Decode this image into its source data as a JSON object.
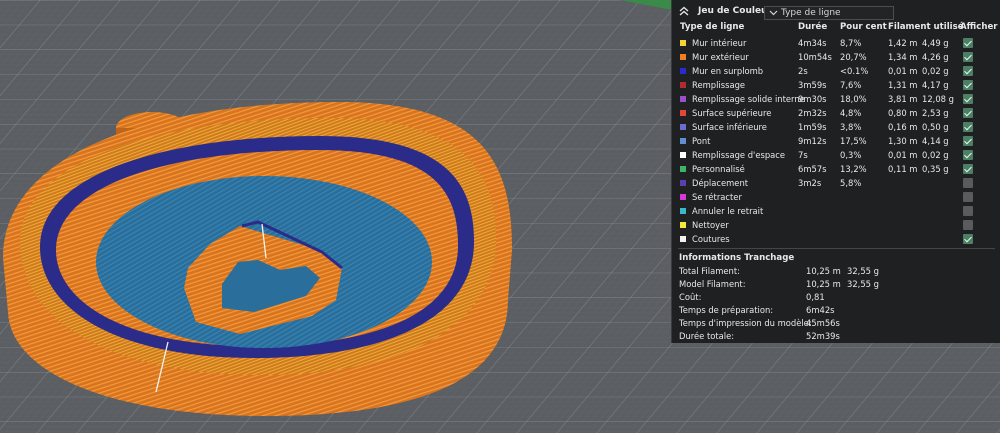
{
  "legend": {
    "title": "Jeu de Couleur",
    "filter_placeholder": "Type de ligne",
    "columns": [
      "Type de ligne",
      "Durée",
      "Pour cent",
      "Filament utilisé",
      "Afficher"
    ],
    "rows": [
      {
        "label": "Mur intérieur",
        "color": "#f2d33a",
        "time": "4m34s",
        "percent": "8,7%",
        "meters": "1,42 m",
        "grams": "4,49 g",
        "show": true
      },
      {
        "label": "Mur extérieur",
        "color": "#f07f24",
        "time": "10m54s",
        "percent": "20,7%",
        "meters": "1,34 m",
        "grams": "4,26 g",
        "show": true
      },
      {
        "label": "Mur en surplomb",
        "color": "#2a2ad0",
        "time": "2s",
        "percent": "<0.1%",
        "meters": "0,01 m",
        "grams": "0,02 g",
        "show": true
      },
      {
        "label": "Remplissage",
        "color": "#b22c2c",
        "time": "3m59s",
        "percent": "7,6%",
        "meters": "1,31 m",
        "grams": "4,17 g",
        "show": true
      },
      {
        "label": "Remplissage solide interne",
        "color": "#9a50c8",
        "time": "9m30s",
        "percent": "18,0%",
        "meters": "3,81 m",
        "grams": "12,08 g",
        "show": true
      },
      {
        "label": "Surface supérieure",
        "color": "#e0483a",
        "time": "2m32s",
        "percent": "4,8%",
        "meters": "0,80 m",
        "grams": "2,53 g",
        "show": true
      },
      {
        "label": "Surface inférieure",
        "color": "#6b6bd0",
        "time": "1m59s",
        "percent": "3,8%",
        "meters": "0,16 m",
        "grams": "0,50 g",
        "show": true
      },
      {
        "label": "Pont",
        "color": "#5f8fd0",
        "time": "9m12s",
        "percent": "17,5%",
        "meters": "1,30 m",
        "grams": "4,14 g",
        "show": true
      },
      {
        "label": "Remplissage d'espace",
        "color": "#ffffff",
        "time": "7s",
        "percent": "0,3%",
        "meters": "0,01 m",
        "grams": "0,02 g",
        "show": true
      },
      {
        "label": "Personnalisé",
        "color": "#3cb46a",
        "time": "6m57s",
        "percent": "13,2%",
        "meters": "0,11 m",
        "grams": "0,35 g",
        "show": true
      },
      {
        "label": "Déplacement",
        "color": "#5a3fb0",
        "time": "3m2s",
        "percent": "5,8%",
        "meters": "",
        "grams": "",
        "show": false
      },
      {
        "label": "Se rétracter",
        "color": "#d23cd2",
        "time": "",
        "percent": "",
        "meters": "",
        "grams": "",
        "show": false
      },
      {
        "label": "Annuler le retrait",
        "color": "#38b8c8",
        "time": "",
        "percent": "",
        "meters": "",
        "grams": "",
        "show": false
      },
      {
        "label": "Nettoyer",
        "color": "#f5e83a",
        "time": "",
        "percent": "",
        "meters": "",
        "grams": "",
        "show": false
      },
      {
        "label": "Coutures",
        "color": "#f2f2f2",
        "time": "",
        "percent": "",
        "meters": "",
        "grams": "",
        "show": true
      }
    ]
  },
  "info": {
    "title": "Informations Tranchage",
    "rows": [
      {
        "label": "Total Filament:",
        "v1": "10,25 m",
        "v2": "32,55 g"
      },
      {
        "label": "Model Filament:",
        "v1": "10,25 m",
        "v2": "32,55 g"
      },
      {
        "label": "Coût:",
        "v1": "0,81",
        "v2": ""
      },
      {
        "label": "Temps de préparation:",
        "v1": "6m42s",
        "v2": ""
      },
      {
        "label": "Temps d'impression du modèle:",
        "v1": "45m56s",
        "v2": ""
      },
      {
        "label": "Durée totale:",
        "v1": "52m39s",
        "v2": ""
      }
    ]
  }
}
